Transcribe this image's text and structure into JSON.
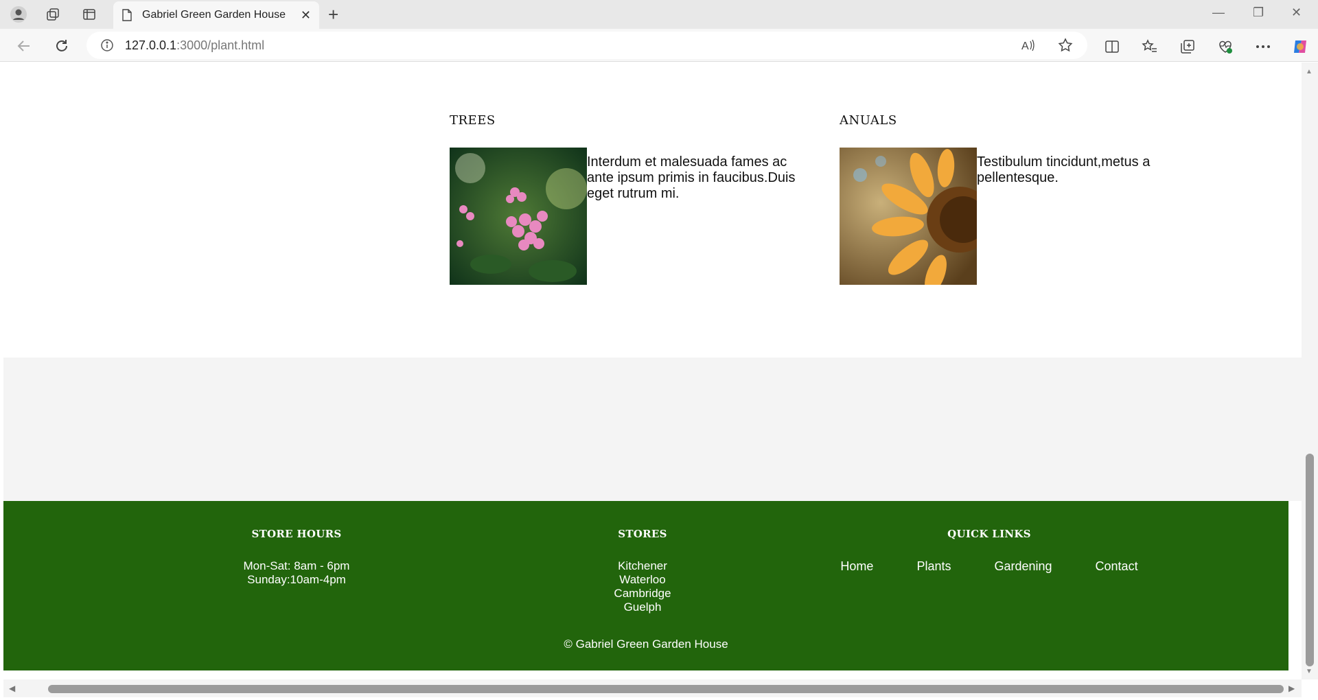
{
  "browser": {
    "tab_title": "Gabriel Green Garden House",
    "url_host": "127.0.0.1",
    "url_path": ":3000/plant.html"
  },
  "cards": [
    {
      "heading": "TREES",
      "text": "Interdum et malesuada fames ac ante ipsum primis in faucibus.Duis eget rutrum mi."
    },
    {
      "heading": "ANUALS",
      "text": "Testibulum tincidunt,metus a pellentesque."
    }
  ],
  "footer": {
    "store_hours": {
      "heading": "STORE HOURS",
      "lines": [
        "Mon-Sat: 8am - 6pm",
        "Sunday:10am-4pm"
      ]
    },
    "stores": {
      "heading": "STORES",
      "lines": [
        "Kitchener",
        "Waterloo",
        "Cambridge",
        "Guelph"
      ]
    },
    "quick_links": {
      "heading": "QUICK LINKS",
      "links": [
        "Home",
        "Plants",
        "Gardening",
        "Contact"
      ]
    },
    "copyright": "© Gabriel Green Garden House"
  },
  "colors": {
    "footer_bg": "#22650c",
    "band_bg": "#f4f4f4"
  }
}
